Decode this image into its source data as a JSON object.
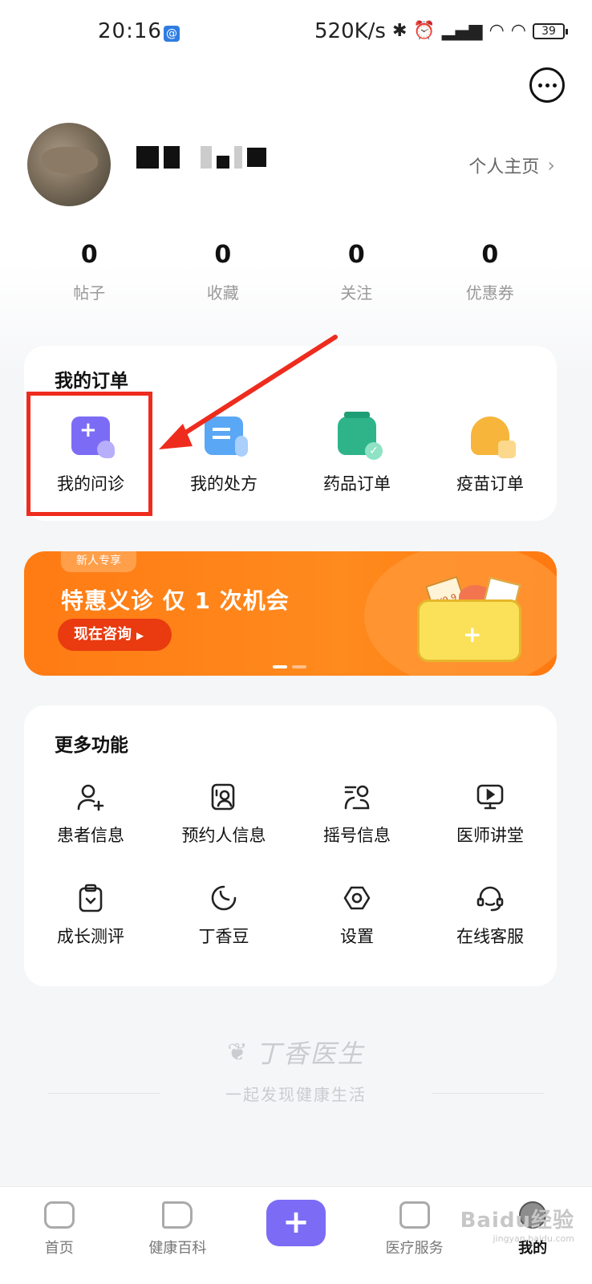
{
  "status_bar": {
    "time": "20:16",
    "speed": "520K/s",
    "battery": "39"
  },
  "profile": {
    "home_link_label": "个人主页"
  },
  "stats": [
    {
      "value": "0",
      "label": "帖子"
    },
    {
      "value": "0",
      "label": "收藏"
    },
    {
      "value": "0",
      "label": "关注"
    },
    {
      "value": "0",
      "label": "优惠券"
    }
  ],
  "orders": {
    "title": "我的订单",
    "items": [
      {
        "label": "我的问诊",
        "icon": "consultation-icon"
      },
      {
        "label": "我的处方",
        "icon": "prescription-icon"
      },
      {
        "label": "药品订单",
        "icon": "drug-order-icon"
      },
      {
        "label": "疫苗订单",
        "icon": "vaccine-order-icon"
      }
    ]
  },
  "banner": {
    "tag": "新人专享",
    "title": "特惠义诊 仅 1 次机会",
    "button": "现在咨询",
    "ticket_text": "¥9.9"
  },
  "more": {
    "title": "更多功能",
    "items": [
      {
        "label": "患者信息",
        "icon": "add-user-icon"
      },
      {
        "label": "预约人信息",
        "icon": "contact-card-icon"
      },
      {
        "label": "摇号信息",
        "icon": "lottery-icon"
      },
      {
        "label": "医师讲堂",
        "icon": "video-lecture-icon"
      },
      {
        "label": "成长测评",
        "icon": "clipboard-icon"
      },
      {
        "label": "丁香豆",
        "icon": "bean-icon"
      },
      {
        "label": "设置",
        "icon": "settings-icon"
      },
      {
        "label": "在线客服",
        "icon": "headset-icon"
      }
    ]
  },
  "brand": {
    "name": "丁香医生",
    "slogan": "一起发现健康生活"
  },
  "tabbar": [
    {
      "label": "首页",
      "icon": "home-icon"
    },
    {
      "label": "健康百科",
      "icon": "book-icon"
    },
    {
      "label": "",
      "icon": "plus-icon"
    },
    {
      "label": "医疗服务",
      "icon": "medical-kit-icon"
    },
    {
      "label": "我的",
      "icon": "profile-icon",
      "active": true
    }
  ],
  "watermark": {
    "text": "Baidu经验",
    "sub": "jingyan.baidu.com"
  },
  "colors": {
    "accent_purple": "#7c6cf5",
    "banner_orange": "#ff8a1d",
    "highlight_red": "#ee2c1e"
  }
}
